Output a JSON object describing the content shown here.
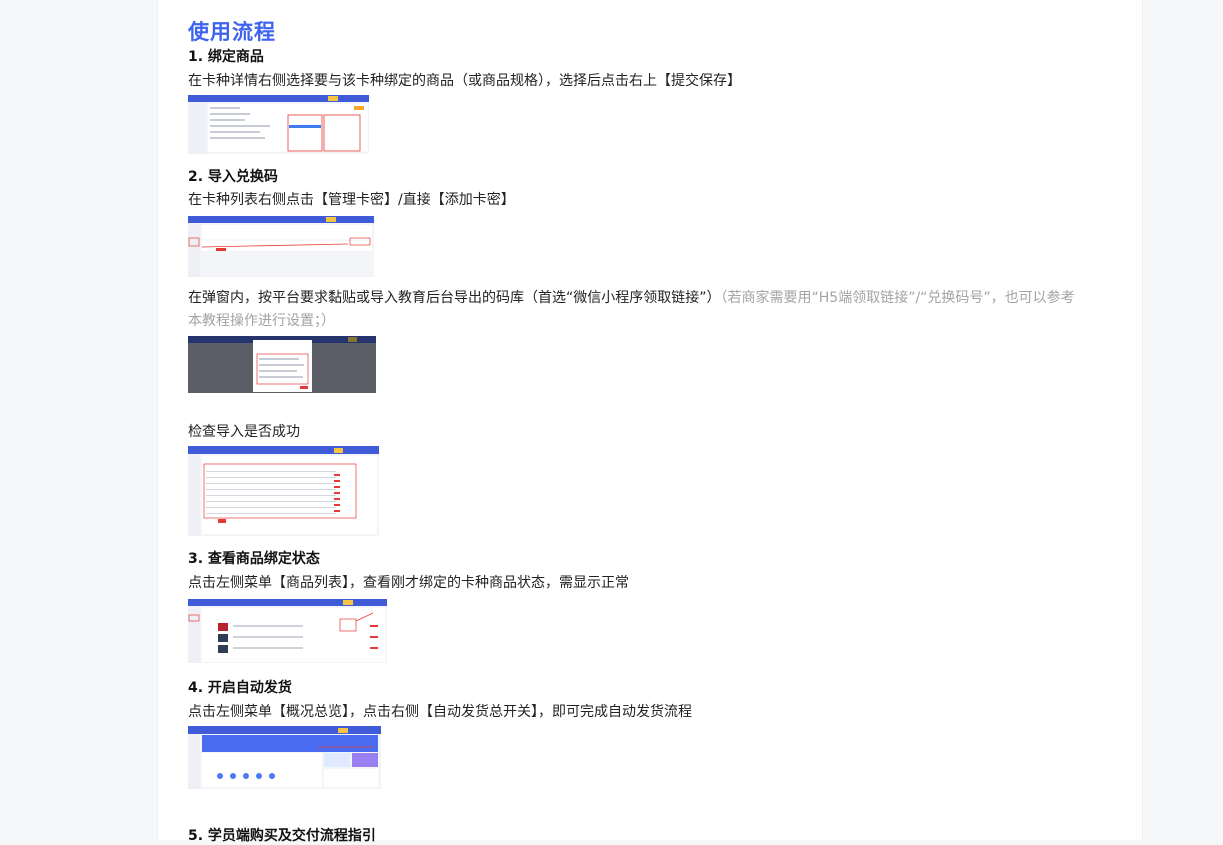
{
  "title": "使用流程",
  "steps": [
    {
      "heading": "1. 绑定商品",
      "text": "在卡种详情右侧选择要与该卡种绑定的商品（或商品规格），选择后点击右上【提交保存】"
    },
    {
      "heading": "2. 导入兑换码",
      "text": "在卡种列表右侧点击【管理卡密】/直接【添加卡密】",
      "text2": "在弹窗内，按平台要求黏贴或导入教育后台导出的码库（首选“微信小程序领取链接”）",
      "text2_note": "（若商家需要用“H5端领取链接”/“兑换码号”，也可以参考本教程操作进行设置；）",
      "text3": "检查导入是否成功"
    },
    {
      "heading": "3. 查看商品绑定状态",
      "text": "点击左侧菜单【商品列表】，查看刚才绑定的卡种商品状态，需显示正常"
    },
    {
      "heading": "4. 开启自动发货",
      "text": "点击左侧菜单【概况总览】，点击右侧【自动发货总开关】，即可完成自动发货流程"
    },
    {
      "heading": "5. 学员端购买及交付流程指引"
    }
  ],
  "colors": {
    "accent": "#3d63f0",
    "muted": "#a3a3a3",
    "highlight": "#e53935"
  },
  "screenshots": [
    {
      "name": "bind-product-screenshot"
    },
    {
      "name": "card-list-screenshot"
    },
    {
      "name": "import-dialog-screenshot"
    },
    {
      "name": "import-check-screenshot"
    },
    {
      "name": "product-list-screenshot"
    },
    {
      "name": "overview-screenshot"
    }
  ]
}
